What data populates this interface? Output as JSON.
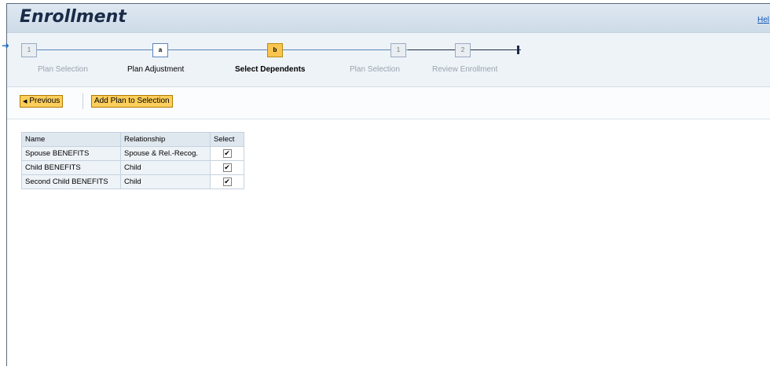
{
  "header": {
    "title": "Enrollment",
    "help": "Hel"
  },
  "roadmap": {
    "steps": [
      {
        "box": "1",
        "label": "Plan Selection"
      },
      {
        "box": "a",
        "label": "Plan Adjustment"
      },
      {
        "box": "b",
        "label": "Select Dependents"
      },
      {
        "box": "1",
        "label": "Plan Selection"
      },
      {
        "box": "2",
        "label": "Review Enrollment"
      }
    ]
  },
  "toolbar": {
    "previous_label": "Previous",
    "add_label": "Add Plan to Selection"
  },
  "table": {
    "headers": [
      "Name",
      "Relationship",
      "Select"
    ],
    "rows": [
      {
        "name": "Spouse BENEFITS",
        "relationship": "Spouse & Rel.-Recog.",
        "selected": true
      },
      {
        "name": "Child BENEFITS",
        "relationship": "Child",
        "selected": true
      },
      {
        "name": "Second Child BENEFITS",
        "relationship": "Child",
        "selected": true
      }
    ]
  }
}
